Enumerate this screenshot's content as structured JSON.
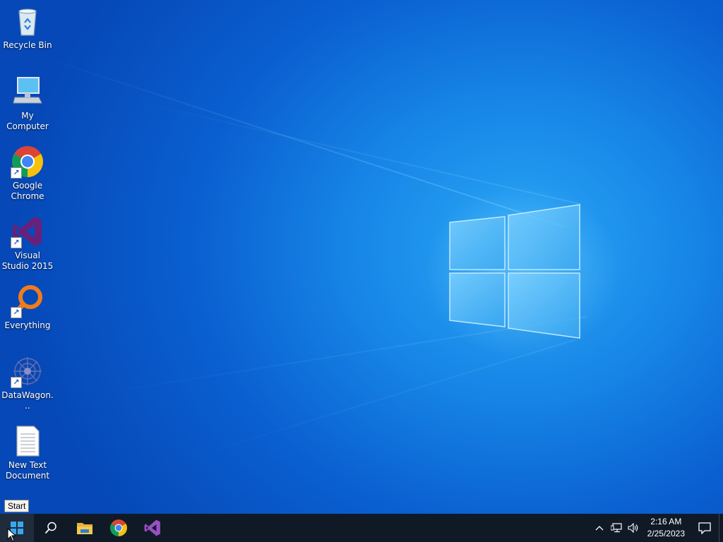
{
  "desktop": {
    "icons": [
      {
        "label": "Recycle Bin",
        "icon": "recycle-bin-icon"
      },
      {
        "label": "My Computer",
        "icon": "computer-icon"
      },
      {
        "label": "Google Chrome",
        "icon": "chrome-icon"
      },
      {
        "label": "Visual Studio 2015",
        "icon": "visual-studio-icon"
      },
      {
        "label": "Everything",
        "icon": "everything-search-icon"
      },
      {
        "label": "DataWagon...",
        "icon": "datawagon-icon"
      },
      {
        "label": "New Text Document",
        "icon": "text-document-icon"
      }
    ]
  },
  "tooltip": {
    "text": "Start"
  },
  "taskbar": {
    "buttons": [
      {
        "name": "start",
        "icon": "windows-logo-icon"
      },
      {
        "name": "search",
        "icon": "search-icon"
      },
      {
        "name": "file-explorer",
        "icon": "folder-icon"
      },
      {
        "name": "chrome",
        "icon": "chrome-icon"
      },
      {
        "name": "visual-studio",
        "icon": "visual-studio-icon"
      }
    ],
    "tray": {
      "icons": [
        "chevron-up-icon",
        "network-icon",
        "volume-icon"
      ],
      "time": "2:16 AM",
      "date": "2/25/2023",
      "notification_icon": "action-center-icon"
    }
  },
  "colors": {
    "taskbar": "#101a26",
    "desktop_accent": "#1684e6",
    "chrome_red": "#db4437",
    "chrome_yellow": "#f4c20d",
    "chrome_green": "#0f9d58",
    "chrome_blue": "#4285f4",
    "vs_purple": "#68217a",
    "everything_orange": "#f07c1b"
  }
}
